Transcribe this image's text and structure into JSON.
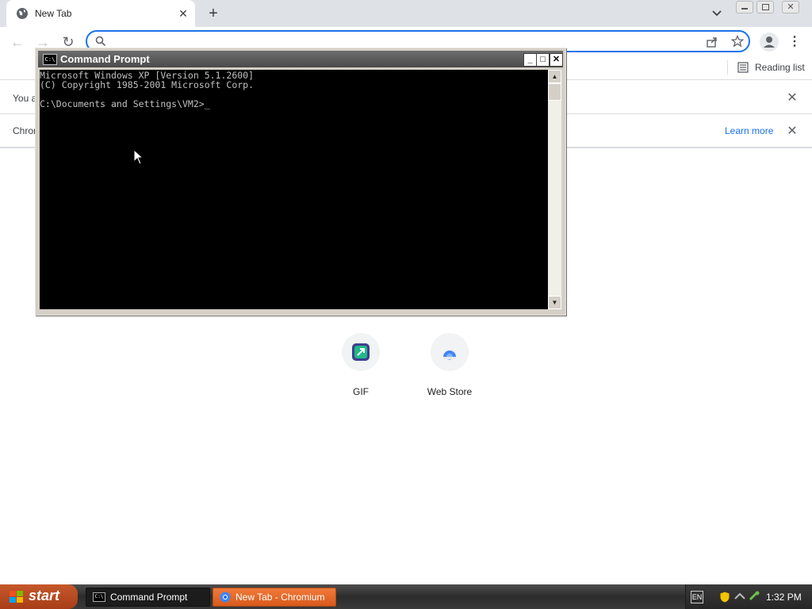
{
  "browser": {
    "tab_title": "New Tab",
    "reading_list": "Reading list",
    "infobar1_text": "You a",
    "infobar2_text": "Chror",
    "learn_more": "Learn more",
    "shortcuts": [
      {
        "label": "GIF",
        "icon": "gif-app-icon"
      },
      {
        "label": "Web Store",
        "icon": "web-store-icon"
      }
    ],
    "accent": "#1a73e8"
  },
  "cmd": {
    "title": "Command Prompt",
    "line1": "Microsoft Windows XP [Version 5.1.2600]",
    "line2": "(C) Copyright 1985-2001 Microsoft Corp.",
    "prompt": "C:\\Documents and Settings\\VM2>_"
  },
  "taskbar": {
    "start": "start",
    "task1": "Command Prompt",
    "task2": "New Tab - Chromium",
    "clock": "1:32 PM"
  }
}
